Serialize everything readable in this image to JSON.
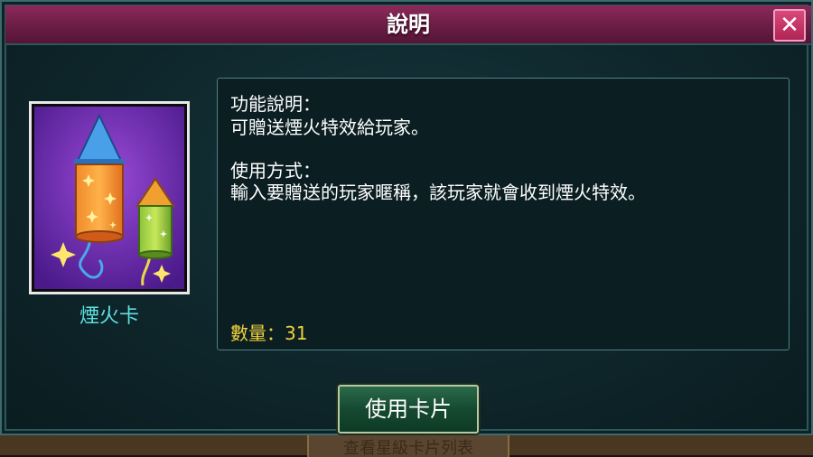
{
  "dialog": {
    "title": "說明",
    "close_label": "✕"
  },
  "card": {
    "name": "煙火卡"
  },
  "description": {
    "function_heading": "功能說明：",
    "function_text": "可贈送煙火特效給玩家。",
    "usage_heading": "使用方式：",
    "usage_text": "輸入要贈送的玩家暱稱，該玩家就會收到煙火特效。",
    "quantity_label": "數量：31"
  },
  "actions": {
    "use_label": "使用卡片"
  },
  "background": {
    "partial_text": "查看星級卡片列表"
  },
  "colors": {
    "titlebar": "#6a1d45",
    "panel": "#0e262b",
    "card_name": "#5ee0e0",
    "quantity": "#f0d23c"
  }
}
